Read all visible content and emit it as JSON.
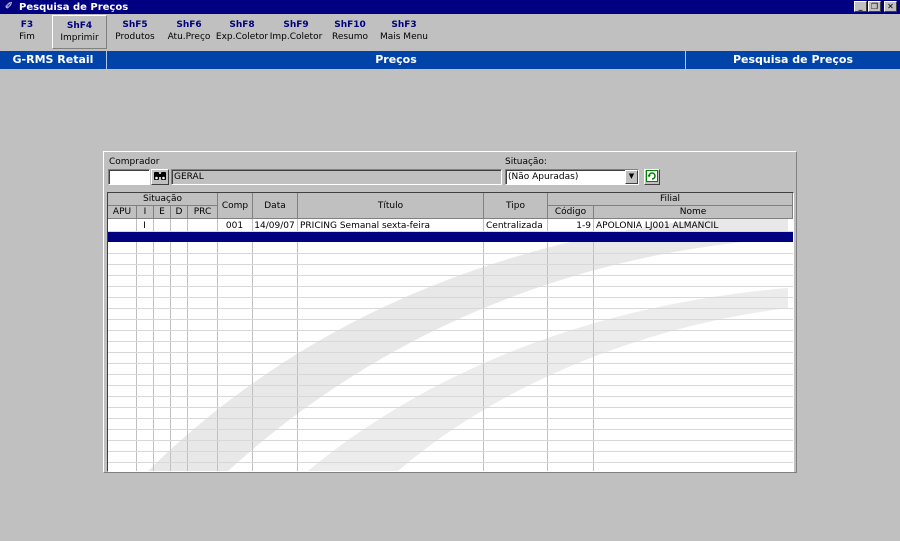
{
  "window": {
    "title": "Pesquisa de Preços"
  },
  "toolbar": [
    {
      "key": "F3",
      "label": "Fim"
    },
    {
      "key": "ShF4",
      "label": "Imprimir"
    },
    {
      "key": "ShF5",
      "label": "Produtos"
    },
    {
      "key": "ShF6",
      "label": "Atu.Preço"
    },
    {
      "key": "ShF8",
      "label": "Exp.Coletor"
    },
    {
      "key": "ShF9",
      "label": "Imp.Coletor"
    },
    {
      "key": "ShF10",
      "label": "Resumo"
    },
    {
      "key": "ShF3",
      "label": "Mais Menu"
    }
  ],
  "band": {
    "left": "G-RMS Retail",
    "center": "Preços",
    "right": "Pesquisa de Preços"
  },
  "form": {
    "comprador_label": "Comprador",
    "comprador_code": "",
    "comprador_name": "GERAL",
    "situacao_label": "Situação:",
    "situacao_value": "(Não Apuradas)"
  },
  "grid": {
    "group_headers": {
      "situacao": "Situação",
      "filial": "Filial"
    },
    "columns": {
      "apu": "APU",
      "i": "I",
      "e": "E",
      "d": "D",
      "prc": "PRC",
      "comp": "Comp",
      "data": "Data",
      "titulo": "Título",
      "tipo": "Tipo",
      "codigo": "Código",
      "nome": "Nome"
    },
    "rows": [
      {
        "apu": "",
        "i": "I",
        "e": "",
        "d": "",
        "prc": "",
        "comp": "001",
        "data": "14/09/07",
        "titulo": "PRICING Semanal sexta-feira",
        "tipo": "Centralizada",
        "codigo": "1-9",
        "nome": "APOLONIA LJ001 ALMANCIL"
      }
    ]
  }
}
